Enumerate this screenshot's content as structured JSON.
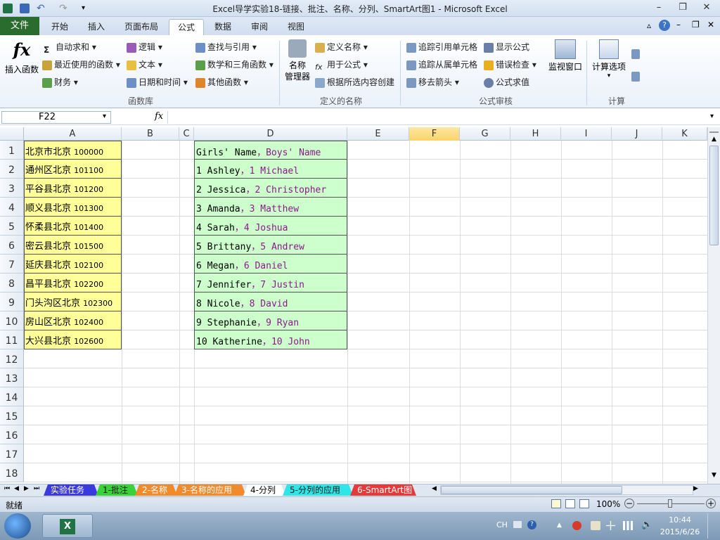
{
  "window": {
    "title": "Excel导学实验18-链接、批注、名称、分列、SmartArt图1 - Microsoft Excel",
    "minimize": "–",
    "restore": "❐",
    "close": "✕"
  },
  "ribbon_tabs": {
    "file": "文件",
    "items": [
      "开始",
      "插入",
      "页面布局",
      "公式",
      "数据",
      "审阅",
      "视图"
    ],
    "active": "公式"
  },
  "ribbon": {
    "insert_function": "插入函数",
    "fx_symbol": "fx",
    "function_library": {
      "autosum": "自动求和",
      "recent": "最近使用的函数",
      "financial": "财务",
      "logical": "逻辑",
      "text": "文本",
      "datetime": "日期和时间",
      "lookup": "查找与引用",
      "math": "数学和三角函数",
      "more": "其他函数",
      "label": "函数库"
    },
    "defined_names": {
      "name_manager_1": "名称",
      "name_manager_2": "管理器",
      "define_name": "定义名称",
      "use_in_formula": "用于公式",
      "create_from_selection": "根据所选内容创建",
      "label": "定义的名称"
    },
    "formula_auditing": {
      "trace_precedents": "追踪引用单元格",
      "trace_dependents": "追踪从属单元格",
      "remove_arrows": "移去箭头",
      "show_formulas": "显示公式",
      "error_checking": "错误检查",
      "evaluate_formula": "公式求值",
      "watch_window": "监视窗口",
      "label": "公式审核"
    },
    "calculation": {
      "options": "计算选项",
      "label": "计算"
    }
  },
  "formula_bar": {
    "name_box": "F22",
    "fx": "fx",
    "value": ""
  },
  "columns": [
    "A",
    "B",
    "C",
    "D",
    "E",
    "F",
    "G",
    "H",
    "I",
    "J",
    "K"
  ],
  "active_column": "F",
  "rows": [
    "1",
    "2",
    "3",
    "4",
    "5",
    "6",
    "7",
    "8",
    "9",
    "10",
    "11",
    "12",
    "13",
    "14",
    "15",
    "16",
    "17",
    "18"
  ],
  "column_a": [
    {
      "name": "北京市北京",
      "zip": "100000"
    },
    {
      "name": "通州区北京",
      "zip": "101100"
    },
    {
      "name": "平谷县北京",
      "zip": "101200"
    },
    {
      "name": "顺义县北京",
      "zip": "101300"
    },
    {
      "name": "怀柔县北京",
      "zip": "101400"
    },
    {
      "name": "密云县北京",
      "zip": "101500"
    },
    {
      "name": "延庆县北京",
      "zip": "102100"
    },
    {
      "name": "昌平县北京",
      "zip": "102200"
    },
    {
      "name": "门头沟区北京",
      "zip": "102300"
    },
    {
      "name": "房山区北京",
      "zip": "102400"
    },
    {
      "name": "大兴县北京",
      "zip": "102600"
    }
  ],
  "column_d": [
    {
      "girl": "Girls' Name",
      "boy": "Boys' Name"
    },
    {
      "girl": "1 Ashley",
      "boy": "1 Michael"
    },
    {
      "girl": "2 Jessica",
      "boy": "2 Christopher"
    },
    {
      "girl": "3 Amanda",
      "boy": "3 Matthew"
    },
    {
      "girl": "4 Sarah",
      "boy": "4 Joshua"
    },
    {
      "girl": "5 Brittany",
      "boy": "5 Andrew"
    },
    {
      "girl": "6 Megan",
      "boy": "6 Daniel"
    },
    {
      "girl": "7 Jennifer",
      "boy": "7 Justin"
    },
    {
      "girl": "8 Nicole",
      "boy": "8 David"
    },
    {
      "girl": "9 Stephanie",
      "boy": "9 Ryan"
    },
    {
      "girl": "10 Katherine",
      "boy": "10 John"
    }
  ],
  "separator": "，",
  "sheet_tabs": [
    {
      "label": "实验任务",
      "color": "#3a3adf",
      "text": "#ffffff"
    },
    {
      "label": "1-批注",
      "color": "#39d239",
      "text": "#1a1a1a"
    },
    {
      "label": "2-名称",
      "color": "#f08a2a",
      "text": "#ffffff"
    },
    {
      "label": "3-名称的应用",
      "color": "#f08a2a",
      "text": "#ffffff"
    },
    {
      "label": "4-分列",
      "color": "#ffffff",
      "text": "#000000"
    },
    {
      "label": "5-分列的应用",
      "color": "#2ee6e6",
      "text": "#1a1a1a"
    },
    {
      "label": "6-SmartArt图",
      "color": "#e63a3a",
      "text": "#ffffff"
    }
  ],
  "status": {
    "ready": "就绪",
    "zoom": "100%"
  },
  "taskbar": {
    "lang": "CH",
    "time": "10:44",
    "date": "2015/6/26"
  }
}
